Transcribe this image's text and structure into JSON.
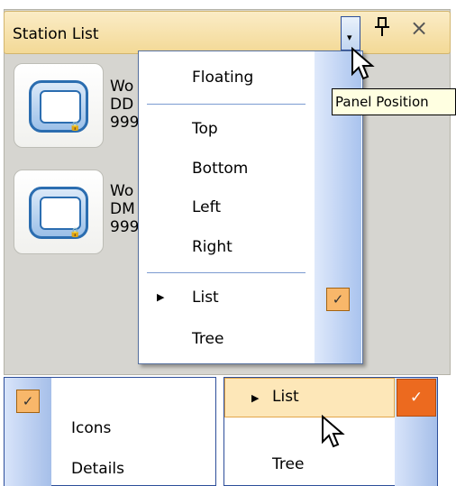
{
  "panel": {
    "title": "Station List",
    "dropdown_glyph": "▾",
    "pin_glyph": "ꟷ",
    "close_glyph": "×"
  },
  "stations": [
    {
      "line1": "Wo",
      "line2": "DD",
      "line3": "999"
    },
    {
      "line1": "Wo",
      "line2": "DM",
      "line3": "999"
    }
  ],
  "menu": {
    "items": {
      "floating": "Floating",
      "top": "Top",
      "bottom": "Bottom",
      "left": "Left",
      "right": "Right",
      "list": "List",
      "tree": "Tree"
    },
    "selected_view": "List",
    "check_glyph": "✓",
    "submenu_glyph": "▶"
  },
  "tooltip": {
    "text": "Panel Position"
  },
  "lower_left_menu": {
    "items": [
      "Icons",
      "Details"
    ],
    "checked": "Icons"
  },
  "lower_right_menu": {
    "items": [
      "List",
      "Tree"
    ],
    "highlighted": "List",
    "checked": "List"
  }
}
